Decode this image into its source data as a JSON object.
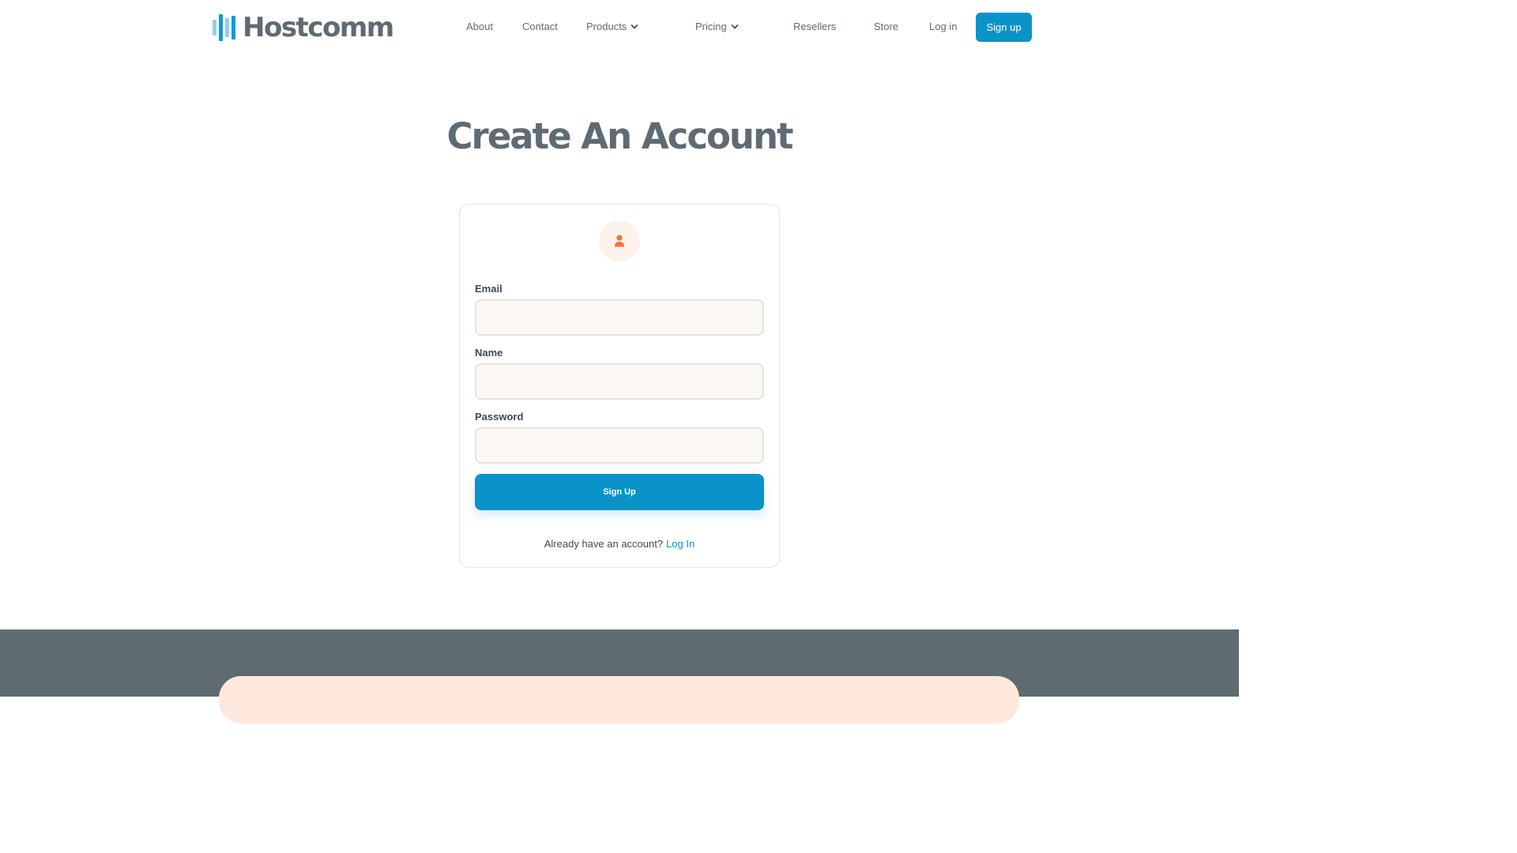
{
  "brand": {
    "name": "Hostcomm",
    "primary_color": "#0a93c9",
    "accent_color": "#e9773a"
  },
  "nav": {
    "about": "About",
    "contact": "Contact",
    "products": "Products",
    "pricing": "Pricing",
    "resellers": "Resellers",
    "store": "Store",
    "login": "Log in",
    "signup": "Sign up"
  },
  "page": {
    "title": "Create An Account"
  },
  "form": {
    "email_label": "Email",
    "email_value": "",
    "name_label": "Name",
    "name_value": "",
    "password_label": "Password",
    "password_value": "",
    "submit_label": "Sign Up",
    "login_prompt": "Already have an account?",
    "login_link": "Log In",
    "avatar_icon": "user-icon"
  }
}
